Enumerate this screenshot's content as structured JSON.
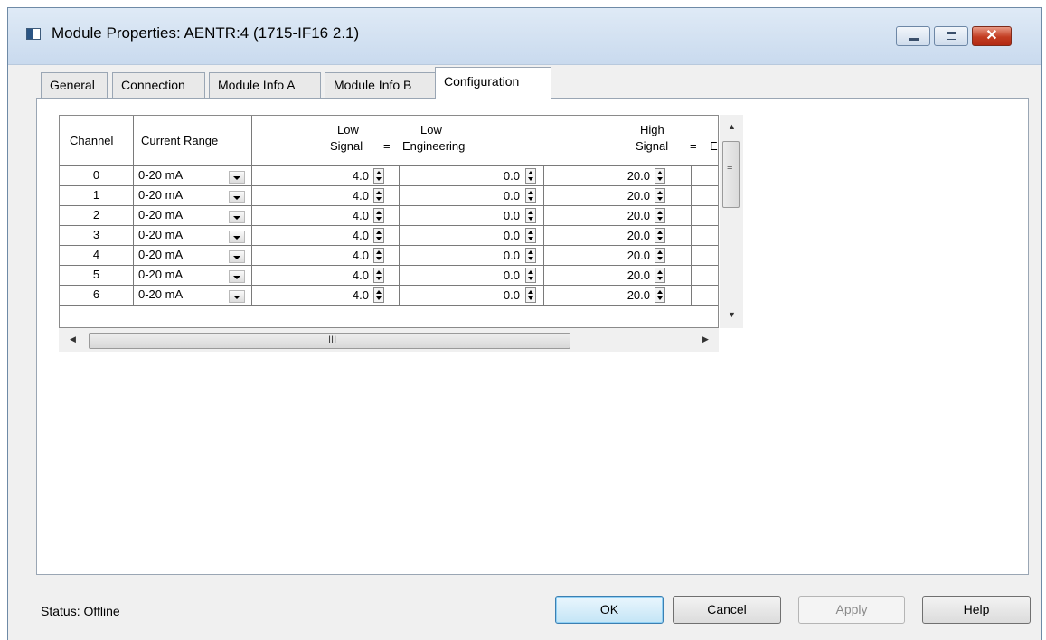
{
  "window": {
    "title": "Module Properties: AENTR:4 (1715-IF16 2.1)",
    "close_glyph": "✕"
  },
  "tabs": [
    "General",
    "Connection",
    "Module Info A",
    "Module Info B",
    "Configuration"
  ],
  "active_tab": "Configuration",
  "grid": {
    "headers": {
      "channel": "Channel",
      "current_range": "Current Range",
      "low_signal_top": "Low",
      "low_signal_bottom": "Signal",
      "low_eq": "=",
      "low_eng_top": "Low",
      "low_eng_bottom": "Engineering",
      "high_signal_top": "High",
      "high_signal_bottom": "Signal",
      "high_eq": "=",
      "high_eng_partial": "Er"
    },
    "rows": [
      {
        "channel": "0",
        "range": "0-20 mA",
        "low_signal": "4.0",
        "low_eng": "0.0",
        "high_signal": "20.0"
      },
      {
        "channel": "1",
        "range": "0-20 mA",
        "low_signal": "4.0",
        "low_eng": "0.0",
        "high_signal": "20.0"
      },
      {
        "channel": "2",
        "range": "0-20 mA",
        "low_signal": "4.0",
        "low_eng": "0.0",
        "high_signal": "20.0"
      },
      {
        "channel": "3",
        "range": "0-20 mA",
        "low_signal": "4.0",
        "low_eng": "0.0",
        "high_signal": "20.0"
      },
      {
        "channel": "4",
        "range": "0-20 mA",
        "low_signal": "4.0",
        "low_eng": "0.0",
        "high_signal": "20.0"
      },
      {
        "channel": "5",
        "range": "0-20 mA",
        "low_signal": "4.0",
        "low_eng": "0.0",
        "high_signal": "20.0"
      },
      {
        "channel": "6",
        "range": "0-20 mA",
        "low_signal": "4.0",
        "low_eng": "0.0",
        "high_signal": "20.0"
      }
    ]
  },
  "scrollbars": {
    "up": "▲",
    "down": "▼",
    "left": "◀",
    "right": "▶",
    "grip": "III"
  },
  "status": "Status:  Offline",
  "buttons": {
    "ok": "OK",
    "cancel": "Cancel",
    "apply": "Apply",
    "help": "Help"
  },
  "icons": [
    "app-icon",
    "minimize-icon",
    "maximize-icon",
    "close-icon",
    "dropdown-arrow-icon",
    "spin-button-icon"
  ],
  "colors": {
    "titlebar": "#c9daee",
    "close_button": "#c23c21",
    "ok_button": "#c4e5f6"
  }
}
